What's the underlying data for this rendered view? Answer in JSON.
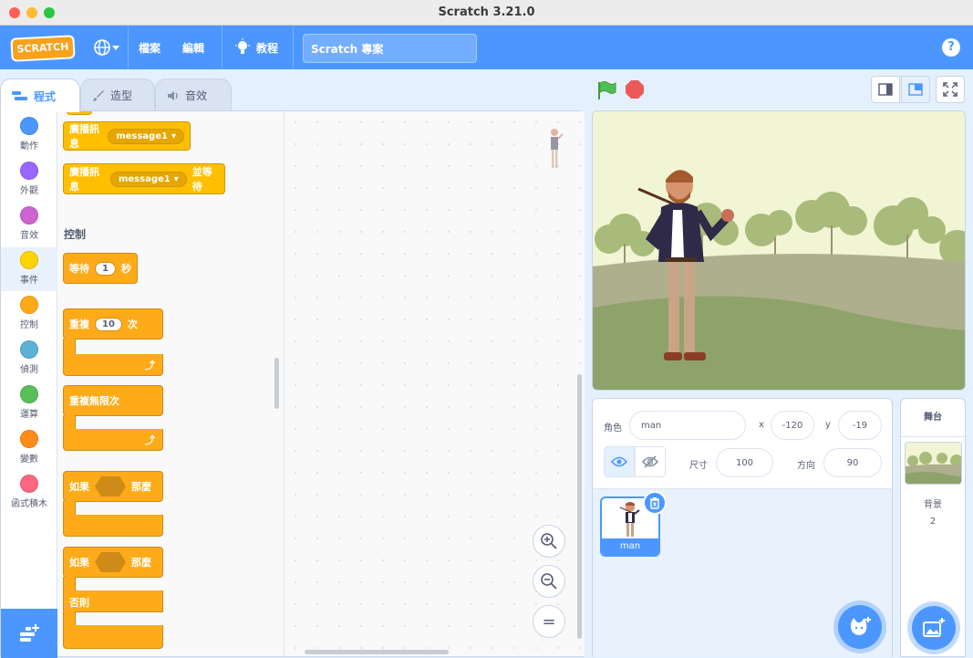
{
  "window": {
    "title": "Scratch 3.21.0"
  },
  "menubar": {
    "logo": "SCRATCH",
    "file": "檔案",
    "edit": "編輯",
    "tutorials": "教程",
    "project_title": "Scratch 專案",
    "help": "?"
  },
  "tabs": [
    {
      "label": "程式",
      "active": true
    },
    {
      "label": "造型"
    },
    {
      "label": "音效"
    }
  ],
  "categories": [
    {
      "label": "動作",
      "color": "#4c97ff"
    },
    {
      "label": "外觀",
      "color": "#9966ff"
    },
    {
      "label": "音效",
      "color": "#cf63cf"
    },
    {
      "label": "事件",
      "color": "#ffd500",
      "active": true
    },
    {
      "label": "控制",
      "color": "#ffab19"
    },
    {
      "label": "偵測",
      "color": "#5cb1d6"
    },
    {
      "label": "運算",
      "color": "#59c059"
    },
    {
      "label": "變數",
      "color": "#ff8c1a"
    },
    {
      "label": "函式積木",
      "color": "#ff6680"
    }
  ],
  "blocks": {
    "broadcast": {
      "label": "廣播訊息",
      "value": "message1"
    },
    "broadcast_wait": {
      "label": "廣播訊息",
      "value": "message1",
      "suffix": "並等待"
    },
    "control_section": "控制",
    "wait": {
      "label": "等待",
      "value": "1",
      "unit": "秒"
    },
    "repeat": {
      "label": "重複",
      "value": "10",
      "unit": "次"
    },
    "forever": {
      "label": "重複無限次"
    },
    "if_then": {
      "if": "如果",
      "then": "那麼"
    },
    "if_else": {
      "if": "如果",
      "then": "那麼",
      "else": "否則"
    }
  },
  "zoom": {
    "in": "+",
    "out": "−",
    "reset": "="
  },
  "sprite_info": {
    "sprite_label": "角色",
    "sprite_name": "man",
    "x_label": "x",
    "x": "-120",
    "y_label": "y",
    "y": "-19",
    "size_label": "尺寸",
    "size": "100",
    "direction_label": "方向",
    "direction": "90"
  },
  "sprites": [
    {
      "name": "man",
      "selected": true
    }
  ],
  "stage_panel": {
    "title": "舞台",
    "backdrops_label": "背景",
    "backdrop_count": "2"
  }
}
